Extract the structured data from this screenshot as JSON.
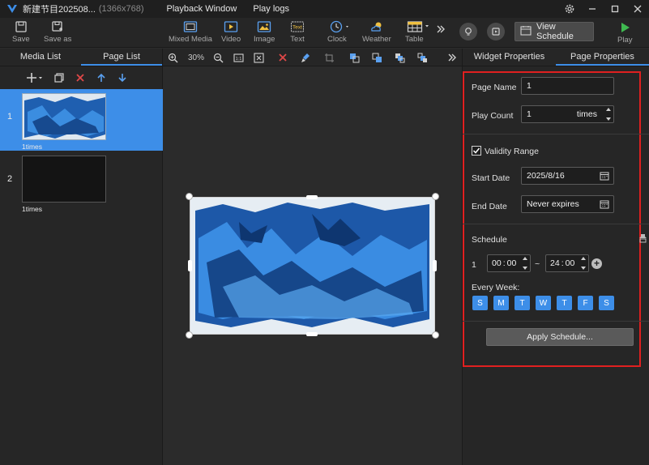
{
  "titlebar": {
    "title": "新建节目202508...",
    "resolution": "(1366x768)",
    "menu": [
      "Playback Window",
      "Play logs"
    ]
  },
  "toolbar": {
    "save": "Save",
    "save_as": "Save as",
    "mixed_media": "Mixed Media",
    "video": "Video",
    "image": "Image",
    "text": "Text",
    "text_icon_label": "Text",
    "clock": "Clock",
    "weather": "Weather",
    "table": "Table",
    "view_schedule": "View Schedule",
    "play": "Play"
  },
  "left_panel": {
    "tabs": [
      "Media List",
      "Page List"
    ],
    "active_tab": "Page List",
    "pages": [
      {
        "number": "1",
        "play_count": "1times",
        "selected": true
      },
      {
        "number": "2",
        "play_count": "1times",
        "selected": false
      }
    ]
  },
  "canvas": {
    "zoom": "30%"
  },
  "right_panel": {
    "tabs": [
      "Widget Properties",
      "Page Properties"
    ],
    "active_tab": "Page Properties",
    "page_name_label": "Page Name",
    "page_name_value": "1",
    "play_count_label": "Play Count",
    "play_count_value": "1",
    "play_count_unit": "times",
    "validity_label": "Validity Range",
    "validity_checked": true,
    "start_date_label": "Start Date",
    "start_date_value": "2025/8/16",
    "end_date_label": "End Date",
    "end_date_value": "Never expires",
    "schedule_label": "Schedule",
    "schedule_index": "1",
    "start_time_h": "00",
    "start_time_m": "00",
    "time_separator": "~",
    "end_time_h": "24",
    "end_time_m": "00",
    "every_week_label": "Every Week:",
    "days": [
      "S",
      "M",
      "T",
      "W",
      "T",
      "F",
      "S"
    ],
    "apply_button": "Apply Schedule..."
  },
  "colors": {
    "accent": "#3d8ee8",
    "highlight_border": "#e02020",
    "play_green": "#3fb950"
  }
}
